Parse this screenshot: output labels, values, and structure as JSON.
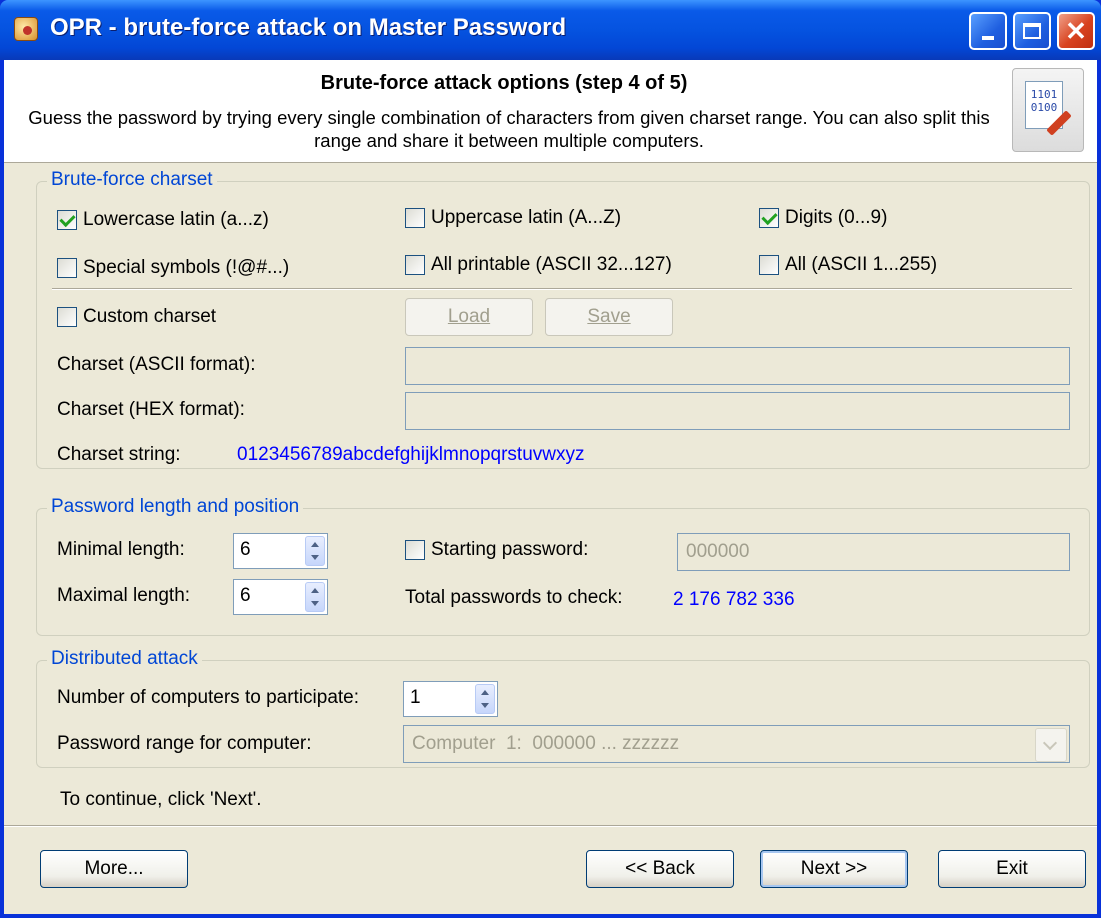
{
  "window": {
    "title": "OPR - brute-force attack on Master Password"
  },
  "header": {
    "title": "Brute-force attack options (step 4 of 5)",
    "description": "Guess the password by trying every single combination of characters from given charset range. You can also split this range and share it between multiple computers.",
    "icon_text": "1101\n0100"
  },
  "charset": {
    "legend": "Brute-force charset",
    "lowercase": {
      "label": "Lowercase latin (a...z)",
      "checked": true
    },
    "uppercase": {
      "label": "Uppercase latin (A...Z)",
      "checked": false
    },
    "digits": {
      "label": "Digits (0...9)",
      "checked": true
    },
    "special": {
      "label": "Special symbols (!@#...)",
      "checked": false
    },
    "printable": {
      "label": "All printable (ASCII 32...127)",
      "checked": false
    },
    "all": {
      "label": "All (ASCII 1...255)",
      "checked": false
    },
    "custom": {
      "label": "Custom charset",
      "checked": false
    },
    "load_label": "Load",
    "save_label": "Save",
    "ascii_label": "Charset (ASCII format):",
    "ascii_value": "",
    "hex_label": "Charset (HEX format):",
    "hex_value": "",
    "string_label": "Charset string:",
    "string_value": "0123456789abcdefghijklmnopqrstuvwxyz"
  },
  "length": {
    "legend": "Password length and position",
    "min_label": "Minimal length:",
    "min_value": "6",
    "max_label": "Maximal length:",
    "max_value": "6",
    "start_label": "Starting password:",
    "start_checked": false,
    "start_value": "000000",
    "total_label": "Total passwords to check:",
    "total_value": "2 176 782 336"
  },
  "distributed": {
    "legend": "Distributed attack",
    "computers_label": "Number of computers to participate:",
    "computers_value": "1",
    "range_label": "Password range for computer:",
    "range_value": "Computer  1:  000000 ... zzzzzz"
  },
  "footer": {
    "hint": "To continue, click 'Next'.",
    "more_label": "More...",
    "back_label": "<< Back",
    "next_label": "Next >>",
    "exit_label": "Exit"
  }
}
